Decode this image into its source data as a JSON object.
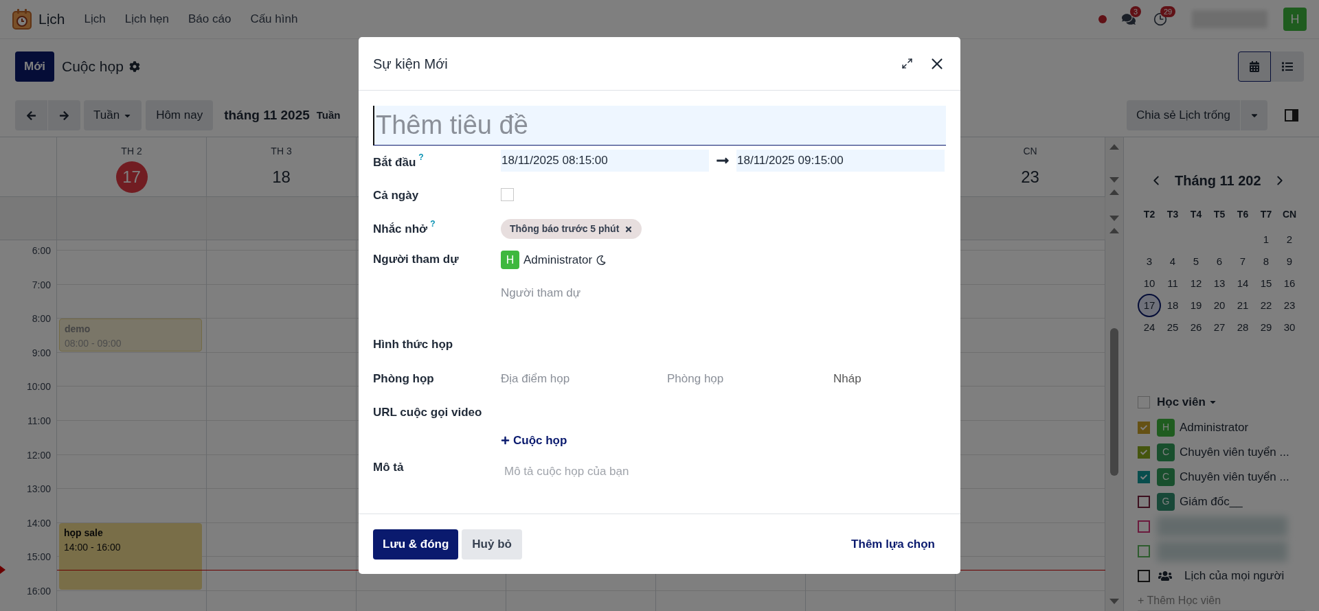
{
  "navbar": {
    "app_name": "Lịch",
    "menu": [
      "Lịch",
      "Lịch hẹn",
      "Báo cáo",
      "Cấu hình"
    ],
    "messages_badge": "3",
    "activities_badge": "29",
    "avatar": "H"
  },
  "control_panel": {
    "new_button": "Mới",
    "breadcrumb": "Cuộc họp",
    "views": [
      {
        "kind": "calendar",
        "selected": true
      },
      {
        "kind": "list",
        "selected": false
      }
    ]
  },
  "toolbar": {
    "scale": "Tuần",
    "today": "Hôm nay",
    "period": "tháng 11 2025",
    "week": "Tuần",
    "share": "Chia sẻ Lịch trống"
  },
  "calendar": {
    "days": [
      {
        "weekday": "TH 2",
        "date": "17",
        "today": true
      },
      {
        "weekday": "TH 3",
        "date": "18",
        "today": false
      },
      {
        "weekday": "CN",
        "date": "23",
        "today": false
      }
    ],
    "hours": [
      "6:00",
      "7:00",
      "8:00",
      "9:00",
      "10:00",
      "11:00",
      "12:00",
      "13:00",
      "14:00",
      "15:00",
      "16:00"
    ],
    "events": [
      {
        "title": "demo",
        "time": "08:00 - 09:00",
        "kind": "pending"
      },
      {
        "title": "họp sale",
        "time": "14:00 - 16:00",
        "kind": "confirmed"
      }
    ]
  },
  "sidebar": {
    "month": "Tháng 11 202",
    "weekdays": [
      "T2",
      "T3",
      "T4",
      "T5",
      "T6",
      "T7",
      "CN"
    ],
    "weeks": [
      [
        {
          "day": "1",
          "selected": false
        },
        {
          "day": "2",
          "selected": false
        }
      ],
      [
        {
          "day": "3",
          "selected": false
        },
        {
          "day": "4",
          "selected": false
        },
        {
          "day": "5",
          "selected": false
        },
        {
          "day": "6",
          "selected": false
        },
        {
          "day": "7",
          "selected": false
        },
        {
          "day": "8",
          "selected": false
        },
        {
          "day": "9",
          "selected": false
        }
      ],
      [
        {
          "day": "10",
          "selected": false
        },
        {
          "day": "11",
          "selected": false
        },
        {
          "day": "12",
          "selected": false
        },
        {
          "day": "13",
          "selected": false
        },
        {
          "day": "14",
          "selected": false
        },
        {
          "day": "15",
          "selected": false
        },
        {
          "day": "16",
          "selected": false
        }
      ],
      [
        {
          "day": "17",
          "selected": true
        },
        {
          "day": "18",
          "selected": false
        },
        {
          "day": "19",
          "selected": false
        },
        {
          "day": "20",
          "selected": false
        },
        {
          "day": "21",
          "selected": false
        },
        {
          "day": "22",
          "selected": false
        },
        {
          "day": "23",
          "selected": false
        }
      ],
      [
        {
          "day": "24",
          "selected": false
        },
        {
          "day": "25",
          "selected": false
        },
        {
          "day": "26",
          "selected": false
        },
        {
          "day": "27",
          "selected": false
        },
        {
          "day": "28",
          "selected": false
        },
        {
          "day": "29",
          "selected": false
        },
        {
          "day": "30",
          "selected": false
        }
      ]
    ],
    "filter_group": {
      "label": "Học viên",
      "checked": false
    },
    "filters": [
      {
        "kind": "person",
        "avatar": {
          "text": "H",
          "color": "#1f5c1f"
        },
        "name": "Administrator",
        "checked": true,
        "color": "#655114"
      },
      {
        "kind": "person",
        "avatar": {
          "text": "C",
          "color": "#184f2d"
        },
        "name": "Chuyên viên tuyển ...",
        "checked": true,
        "color": "#45550e"
      },
      {
        "kind": "person",
        "avatar": {
          "text": "C",
          "color": "#184f2d"
        },
        "name": "Chuyên viên tuyển ...",
        "checked": true,
        "color": "#084d4d"
      },
      {
        "kind": "person",
        "avatar": {
          "text": "G",
          "color": "#184838"
        },
        "name": "Giám đốc__",
        "checked": false,
        "color": "#3d101f"
      },
      {
        "kind": "blurred",
        "checked": false,
        "color": "#6b1a3d"
      },
      {
        "kind": "blurred",
        "checked": false,
        "color": "#2e5c2e"
      },
      {
        "kind": "everyone",
        "name": "Lịch của mọi người",
        "checked": false,
        "color": "#111111"
      }
    ],
    "add_link": "+ Thêm Học viên"
  },
  "dialog": {
    "title": "Sự kiện Mới",
    "name_placeholder": "Thêm tiêu đề",
    "fields": [
      {
        "kind": "daterange",
        "label": "Bắt đầu",
        "help": "?",
        "start": "18/11/2025 08:15:00",
        "end": "18/11/2025 09:15:00"
      },
      {
        "kind": "checkbox",
        "label": "Cả ngày",
        "checked": false
      },
      {
        "kind": "tags",
        "label": "Nhắc nhở",
        "help": "?",
        "tags": [
          "Thông báo trước 5 phút"
        ]
      },
      {
        "kind": "attendees",
        "label": "Người tham dự",
        "attendees": [
          {
            "avatar": "H",
            "name": "Administrator"
          }
        ],
        "placeholder": "Người tham dự"
      },
      {
        "kind": "empty",
        "label": "Hình thức họp"
      },
      {
        "kind": "location",
        "label": "Phòng họp",
        "placeholders": [
          "Địa điểm họp",
          "Phòng họp"
        ],
        "status": "Nháp"
      },
      {
        "kind": "video",
        "label": "URL cuộc gọi video",
        "link": "Cuộc họp"
      },
      {
        "kind": "description",
        "label": "Mô tả",
        "placeholder": "Mô tả cuộc họp của bạn"
      }
    ],
    "save": "Lưu & đóng",
    "cancel": "Huỷ bỏ",
    "more": "Thêm lựa chọn"
  }
}
